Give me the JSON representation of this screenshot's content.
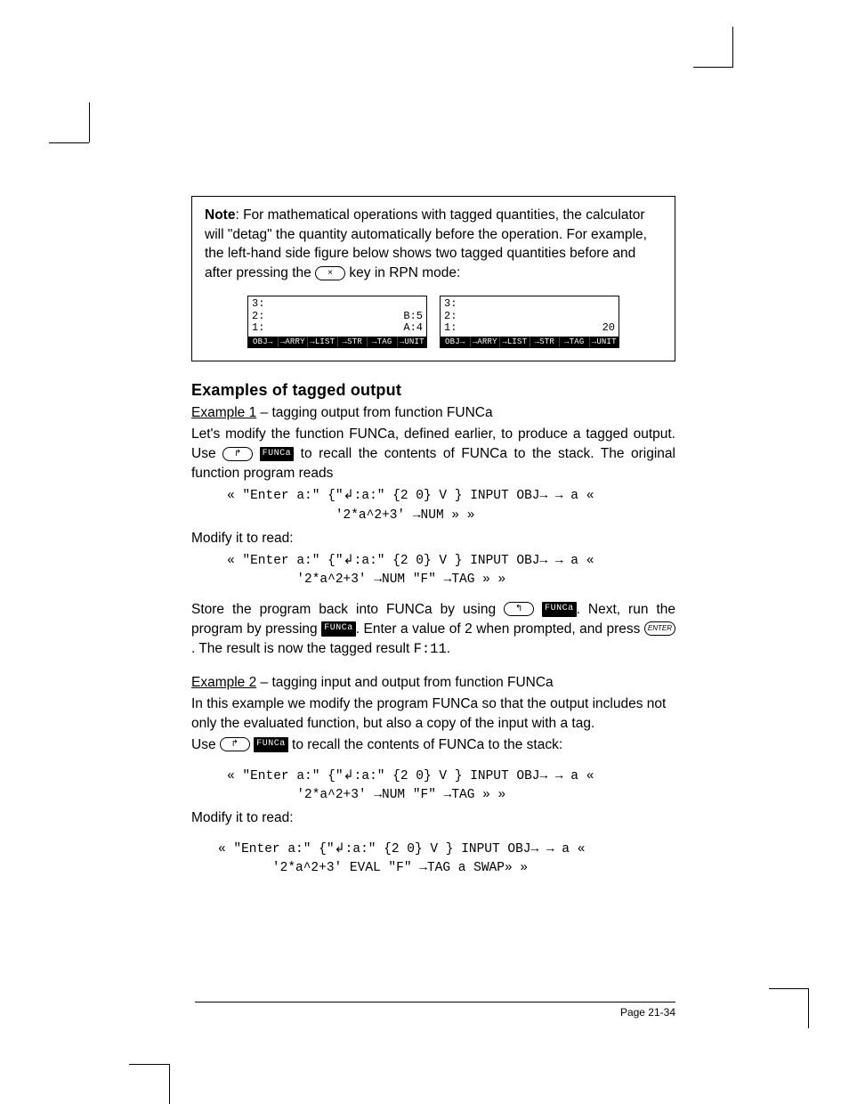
{
  "note": {
    "label": "Note",
    "text": ": For mathematical operations with tagged quantities, the calculator will \"detag\" the quantity automatically before the operation.  For example, the left-hand side figure below shows two tagged quantities before and after pressing the ",
    "text_after_key": " key in RPN mode:",
    "key_symbol": "×"
  },
  "screens": {
    "left": {
      "lines": [
        {
          "l": "3:",
          "r": ""
        },
        {
          "l": "2:",
          "r": "B:5"
        },
        {
          "l": "1:",
          "r": "A:4"
        }
      ],
      "menu": [
        "OBJ→",
        "→ARRY",
        "→LIST",
        "→STR",
        "→TAG",
        "→UNIT"
      ]
    },
    "right": {
      "lines": [
        {
          "l": "3:",
          "r": ""
        },
        {
          "l": "2:",
          "r": ""
        },
        {
          "l": "1:",
          "r": "20"
        }
      ],
      "menu": [
        "OBJ→",
        "→ARRY",
        "→LIST",
        "→STR",
        "→TAG",
        "→UNIT"
      ]
    }
  },
  "section_title": "Examples of tagged output",
  "ex1": {
    "heading": "Example 1",
    "heading_rest": " – tagging output from function FUNCa",
    "p1": "Let's modify the function FUNCa, defined earlier, to produce a tagged output.  Use ",
    "p1b": " to recall the contents of FUNCa to the stack.  The original function program reads",
    "rightshift": "↱",
    "softkey": "FUNCa",
    "code1_l1": "« \"Enter a:\" {\"↲:a:\" {2 0} V } INPUT OBJ→ → a «",
    "code1_l2": "              '2*a^2+3' →NUM » »",
    "modify": "Modify it to read:",
    "code2_l1": "« \"Enter a:\" {\"↲:a:\" {2 0} V } INPUT OBJ→ → a «",
    "code2_l2": "         '2*a^2+3' →NUM \"F\" →TAG » »",
    "store1": "Store the program back into FUNCa by using ",
    "leftshift": "↰",
    "store2": ".  Next, run the program by pressing ",
    "store3": ".  Enter a value of 2 when prompted, and press ",
    "enter_key": "ENTER",
    "store4": ".  The result is now the tagged result ",
    "result": "F:11",
    "store5": "."
  },
  "ex2": {
    "heading": "Example 2",
    "heading_rest": " – tagging input and output from function FUNCa",
    "p1": "In this example we modify the program  FUNCa so that the output includes not only the evaluated function, but also a copy of the input with a tag.",
    "p2a": "Use ",
    "p2b": " to recall the contents of FUNCa to the stack:",
    "code1_l1": "« \"Enter a:\" {\"↲:a:\" {2 0} V } INPUT OBJ→ → a «",
    "code1_l2": "         '2*a^2+3' →NUM \"F\" →TAG » »",
    "modify": "Modify it to read:",
    "code2_l1": "« \"Enter a:\" {\"↲:a:\" {2 0} V } INPUT OBJ→ → a «",
    "code2_l2": "       '2*a^2+3' EVAL \"F\" →TAG a SWAP» »"
  },
  "footer": "Page 21-34"
}
